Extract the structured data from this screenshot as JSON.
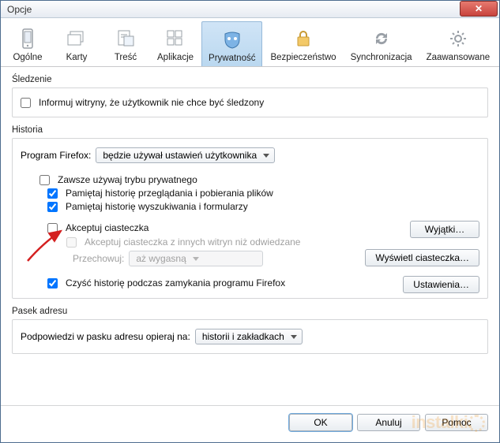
{
  "window": {
    "title": "Opcje",
    "close_label": "✕"
  },
  "tabs": [
    {
      "id": "general",
      "label": "Ogólne"
    },
    {
      "id": "tabs",
      "label": "Karty"
    },
    {
      "id": "content",
      "label": "Treść"
    },
    {
      "id": "apps",
      "label": "Aplikacje"
    },
    {
      "id": "privacy",
      "label": "Prywatność"
    },
    {
      "id": "security",
      "label": "Bezpieczeństwo"
    },
    {
      "id": "sync",
      "label": "Synchronizacja"
    },
    {
      "id": "advanced",
      "label": "Zaawansowane"
    }
  ],
  "tracking": {
    "section_label": "Śledzenie",
    "dnt_label": "Informuj witryny, że użytkownik nie chce być śledzony",
    "dnt_checked": false
  },
  "history": {
    "section_label": "Historia",
    "program_label": "Program Firefox:",
    "mode_value": "będzie używał ustawień użytkownika",
    "always_private": {
      "label": "Zawsze używaj trybu prywatnego",
      "checked": false
    },
    "remember_browse": {
      "label": "Pamiętaj historię przeglądania i pobierania plików",
      "checked": true
    },
    "remember_search": {
      "label": "Pamiętaj historię wyszukiwania i formularzy",
      "checked": true
    },
    "accept_cookies": {
      "label": "Akceptuj ciasteczka",
      "checked": false
    },
    "exceptions_btn": "Wyjątki…",
    "third_party": {
      "label": "Akceptuj ciasteczka z innych witryn niż odwiedzane",
      "checked": false,
      "disabled": true
    },
    "keep_label": "Przechowuj:",
    "keep_value": "aż wygasną",
    "show_cookies_btn": "Wyświetl ciasteczka…",
    "clear_on_close": {
      "label": "Czyść historię podczas zamykania programu Firefox",
      "checked": true
    },
    "settings_btn": "Ustawienia…"
  },
  "locationbar": {
    "section_label": "Pasek adresu",
    "suggest_label": "Podpowiedzi w pasku adresu opieraj na:",
    "suggest_value": "historii i zakładkach"
  },
  "footer": {
    "ok": "OK",
    "cancel": "Anuluj",
    "help": "Pomoc"
  },
  "watermark": "instalki."
}
